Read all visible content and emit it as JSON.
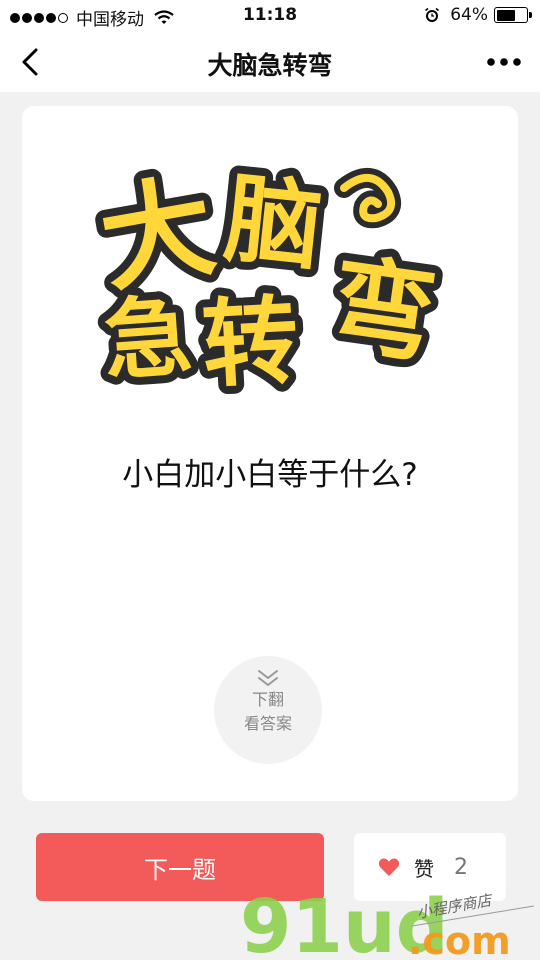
{
  "status_bar": {
    "carrier": "中国移动",
    "time": "11:18",
    "battery": "64%",
    "battery_level": 0.64,
    "signal_dots_filled": 4,
    "signal_dots_total": 5,
    "icons": [
      "wifi-icon",
      "alarm-icon",
      "battery-icon"
    ]
  },
  "nav": {
    "title": "大脑急转弯",
    "back_icon": "chevron-left-icon",
    "more_icon": "more-dots-icon"
  },
  "card": {
    "logo_text": "大脑急转弯",
    "question": "小白加小白等于什么?",
    "flip_line1": "下翻",
    "flip_line2": "看答案",
    "flip_icon": "double-chevron-down-icon"
  },
  "actions": {
    "next_label": "下一题",
    "like_label": "赞",
    "like_count": "2",
    "like_icon": "heart-icon"
  },
  "watermark": {
    "brand": "91ud",
    "domain": ".com",
    "tagline": "小程序商店"
  },
  "colors": {
    "accent_red": "#f35b5b",
    "logo_yellow": "#ffd73a",
    "logo_outline": "#2b2b2b",
    "watermark_green": "#8bd14b",
    "watermark_orange": "#f39a1e"
  }
}
